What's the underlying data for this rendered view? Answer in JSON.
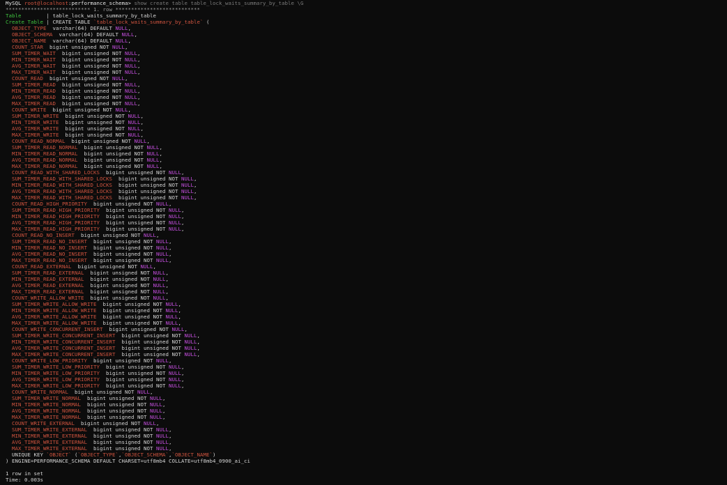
{
  "terminal": {
    "prompt": {
      "product": "MySQL",
      "user_host": "root@localhost",
      "schema": "performance_schema",
      "command": "show create table table_lock_waits_summary_by_table \\G"
    },
    "row_separator": "*************************** 1. row ***************************",
    "table_row": {
      "label": "Table",
      "value": "table_lock_waits_summary_by_table"
    },
    "create_row": {
      "label": "Create Table",
      "keyword": "CREATE TABLE",
      "table_name": "`table_lock_waits_summary_by_table`"
    },
    "columns": [
      {
        "name": "OBJECT_TYPE",
        "type": "varchar(64) DEFAULT",
        "null_kw": "NULL"
      },
      {
        "name": "OBJECT_SCHEMA",
        "type": "varchar(64) DEFAULT",
        "null_kw": "NULL"
      },
      {
        "name": "OBJECT_NAME",
        "type": "varchar(64) DEFAULT",
        "null_kw": "NULL"
      },
      {
        "name": "COUNT_STAR",
        "type": "bigint unsigned NOT",
        "null_kw": "NULL"
      },
      {
        "name": "SUM_TIMER_WAIT",
        "type": "bigint unsigned NOT",
        "null_kw": "NULL"
      },
      {
        "name": "MIN_TIMER_WAIT",
        "type": "bigint unsigned NOT",
        "null_kw": "NULL"
      },
      {
        "name": "AVG_TIMER_WAIT",
        "type": "bigint unsigned NOT",
        "null_kw": "NULL"
      },
      {
        "name": "MAX_TIMER_WAIT",
        "type": "bigint unsigned NOT",
        "null_kw": "NULL"
      },
      {
        "name": "COUNT_READ",
        "type": "bigint unsigned NOT",
        "null_kw": "NULL"
      },
      {
        "name": "SUM_TIMER_READ",
        "type": "bigint unsigned NOT",
        "null_kw": "NULL"
      },
      {
        "name": "MIN_TIMER_READ",
        "type": "bigint unsigned NOT",
        "null_kw": "NULL"
      },
      {
        "name": "AVG_TIMER_READ",
        "type": "bigint unsigned NOT",
        "null_kw": "NULL"
      },
      {
        "name": "MAX_TIMER_READ",
        "type": "bigint unsigned NOT",
        "null_kw": "NULL"
      },
      {
        "name": "COUNT_WRITE",
        "type": "bigint unsigned NOT",
        "null_kw": "NULL"
      },
      {
        "name": "SUM_TIMER_WRITE",
        "type": "bigint unsigned NOT",
        "null_kw": "NULL"
      },
      {
        "name": "MIN_TIMER_WRITE",
        "type": "bigint unsigned NOT",
        "null_kw": "NULL"
      },
      {
        "name": "AVG_TIMER_WRITE",
        "type": "bigint unsigned NOT",
        "null_kw": "NULL"
      },
      {
        "name": "MAX_TIMER_WRITE",
        "type": "bigint unsigned NOT",
        "null_kw": "NULL"
      },
      {
        "name": "COUNT_READ_NORMAL",
        "type": "bigint unsigned NOT",
        "null_kw": "NULL"
      },
      {
        "name": "SUM_TIMER_READ_NORMAL",
        "type": "bigint unsigned NOT",
        "null_kw": "NULL"
      },
      {
        "name": "MIN_TIMER_READ_NORMAL",
        "type": "bigint unsigned NOT",
        "null_kw": "NULL"
      },
      {
        "name": "AVG_TIMER_READ_NORMAL",
        "type": "bigint unsigned NOT",
        "null_kw": "NULL"
      },
      {
        "name": "MAX_TIMER_READ_NORMAL",
        "type": "bigint unsigned NOT",
        "null_kw": "NULL"
      },
      {
        "name": "COUNT_READ_WITH_SHARED_LOCKS",
        "type": "bigint unsigned NOT",
        "null_kw": "NULL"
      },
      {
        "name": "SUM_TIMER_READ_WITH_SHARED_LOCKS",
        "type": "bigint unsigned NOT",
        "null_kw": "NULL"
      },
      {
        "name": "MIN_TIMER_READ_WITH_SHARED_LOCKS",
        "type": "bigint unsigned NOT",
        "null_kw": "NULL"
      },
      {
        "name": "AVG_TIMER_READ_WITH_SHARED_LOCKS",
        "type": "bigint unsigned NOT",
        "null_kw": "NULL"
      },
      {
        "name": "MAX_TIMER_READ_WITH_SHARED_LOCKS",
        "type": "bigint unsigned NOT",
        "null_kw": "NULL"
      },
      {
        "name": "COUNT_READ_HIGH_PRIORITY",
        "type": "bigint unsigned NOT",
        "null_kw": "NULL"
      },
      {
        "name": "SUM_TIMER_READ_HIGH_PRIORITY",
        "type": "bigint unsigned NOT",
        "null_kw": "NULL"
      },
      {
        "name": "MIN_TIMER_READ_HIGH_PRIORITY",
        "type": "bigint unsigned NOT",
        "null_kw": "NULL"
      },
      {
        "name": "AVG_TIMER_READ_HIGH_PRIORITY",
        "type": "bigint unsigned NOT",
        "null_kw": "NULL"
      },
      {
        "name": "MAX_TIMER_READ_HIGH_PRIORITY",
        "type": "bigint unsigned NOT",
        "null_kw": "NULL"
      },
      {
        "name": "COUNT_READ_NO_INSERT",
        "type": "bigint unsigned NOT",
        "null_kw": "NULL"
      },
      {
        "name": "SUM_TIMER_READ_NO_INSERT",
        "type": "bigint unsigned NOT",
        "null_kw": "NULL"
      },
      {
        "name": "MIN_TIMER_READ_NO_INSERT",
        "type": "bigint unsigned NOT",
        "null_kw": "NULL"
      },
      {
        "name": "AVG_TIMER_READ_NO_INSERT",
        "type": "bigint unsigned NOT",
        "null_kw": "NULL"
      },
      {
        "name": "MAX_TIMER_READ_NO_INSERT",
        "type": "bigint unsigned NOT",
        "null_kw": "NULL"
      },
      {
        "name": "COUNT_READ_EXTERNAL",
        "type": "bigint unsigned NOT",
        "null_kw": "NULL"
      },
      {
        "name": "SUM_TIMER_READ_EXTERNAL",
        "type": "bigint unsigned NOT",
        "null_kw": "NULL"
      },
      {
        "name": "MIN_TIMER_READ_EXTERNAL",
        "type": "bigint unsigned NOT",
        "null_kw": "NULL"
      },
      {
        "name": "AVG_TIMER_READ_EXTERNAL",
        "type": "bigint unsigned NOT",
        "null_kw": "NULL"
      },
      {
        "name": "MAX_TIMER_READ_EXTERNAL",
        "type": "bigint unsigned NOT",
        "null_kw": "NULL"
      },
      {
        "name": "COUNT_WRITE_ALLOW_WRITE",
        "type": "bigint unsigned NOT",
        "null_kw": "NULL"
      },
      {
        "name": "SUM_TIMER_WRITE_ALLOW_WRITE",
        "type": "bigint unsigned NOT",
        "null_kw": "NULL"
      },
      {
        "name": "MIN_TIMER_WRITE_ALLOW_WRITE",
        "type": "bigint unsigned NOT",
        "null_kw": "NULL"
      },
      {
        "name": "AVG_TIMER_WRITE_ALLOW_WRITE",
        "type": "bigint unsigned NOT",
        "null_kw": "NULL"
      },
      {
        "name": "MAX_TIMER_WRITE_ALLOW_WRITE",
        "type": "bigint unsigned NOT",
        "null_kw": "NULL"
      },
      {
        "name": "COUNT_WRITE_CONCURRENT_INSERT",
        "type": "bigint unsigned NOT",
        "null_kw": "NULL"
      },
      {
        "name": "SUM_TIMER_WRITE_CONCURRENT_INSERT",
        "type": "bigint unsigned NOT",
        "null_kw": "NULL"
      },
      {
        "name": "MIN_TIMER_WRITE_CONCURRENT_INSERT",
        "type": "bigint unsigned NOT",
        "null_kw": "NULL"
      },
      {
        "name": "AVG_TIMER_WRITE_CONCURRENT_INSERT",
        "type": "bigint unsigned NOT",
        "null_kw": "NULL"
      },
      {
        "name": "MAX_TIMER_WRITE_CONCURRENT_INSERT",
        "type": "bigint unsigned NOT",
        "null_kw": "NULL"
      },
      {
        "name": "COUNT_WRITE_LOW_PRIORITY",
        "type": "bigint unsigned NOT",
        "null_kw": "NULL"
      },
      {
        "name": "SUM_TIMER_WRITE_LOW_PRIORITY",
        "type": "bigint unsigned NOT",
        "null_kw": "NULL"
      },
      {
        "name": "MIN_TIMER_WRITE_LOW_PRIORITY",
        "type": "bigint unsigned NOT",
        "null_kw": "NULL"
      },
      {
        "name": "AVG_TIMER_WRITE_LOW_PRIORITY",
        "type": "bigint unsigned NOT",
        "null_kw": "NULL"
      },
      {
        "name": "MAX_TIMER_WRITE_LOW_PRIORITY",
        "type": "bigint unsigned NOT",
        "null_kw": "NULL"
      },
      {
        "name": "COUNT_WRITE_NORMAL",
        "type": "bigint unsigned NOT",
        "null_kw": "NULL"
      },
      {
        "name": "SUM_TIMER_WRITE_NORMAL",
        "type": "bigint unsigned NOT",
        "null_kw": "NULL"
      },
      {
        "name": "MIN_TIMER_WRITE_NORMAL",
        "type": "bigint unsigned NOT",
        "null_kw": "NULL"
      },
      {
        "name": "AVG_TIMER_WRITE_NORMAL",
        "type": "bigint unsigned NOT",
        "null_kw": "NULL"
      },
      {
        "name": "MAX_TIMER_WRITE_NORMAL",
        "type": "bigint unsigned NOT",
        "null_kw": "NULL"
      },
      {
        "name": "COUNT_WRITE_EXTERNAL",
        "type": "bigint unsigned NOT",
        "null_kw": "NULL"
      },
      {
        "name": "SUM_TIMER_WRITE_EXTERNAL",
        "type": "bigint unsigned NOT",
        "null_kw": "NULL"
      },
      {
        "name": "MIN_TIMER_WRITE_EXTERNAL",
        "type": "bigint unsigned NOT",
        "null_kw": "NULL"
      },
      {
        "name": "AVG_TIMER_WRITE_EXTERNAL",
        "type": "bigint unsigned NOT",
        "null_kw": "NULL"
      },
      {
        "name": "MAX_TIMER_WRITE_EXTERNAL",
        "type": "bigint unsigned NOT",
        "null_kw": "NULL"
      }
    ],
    "unique_key": {
      "keyword": "UNIQUE KEY",
      "name": "`OBJECT`",
      "columns": [
        "`OBJECT_TYPE`",
        "`OBJECT_SCHEMA`",
        "`OBJECT_NAME`"
      ]
    },
    "engine_line": ") ENGINE=PERFORMANCE_SCHEMA DEFAULT CHARSET=utf8mb4 COLLATE=utf8mb4_0900_ai_ci",
    "result_summary": "1 row in set",
    "timing": "Time: 0.003s"
  },
  "colors": {
    "background": "#0c0c0c",
    "default_text": "#d6d6d6",
    "identifier": "#d0543f",
    "keyword_green": "#3fc43f",
    "null_magenta": "#c64fe0"
  }
}
